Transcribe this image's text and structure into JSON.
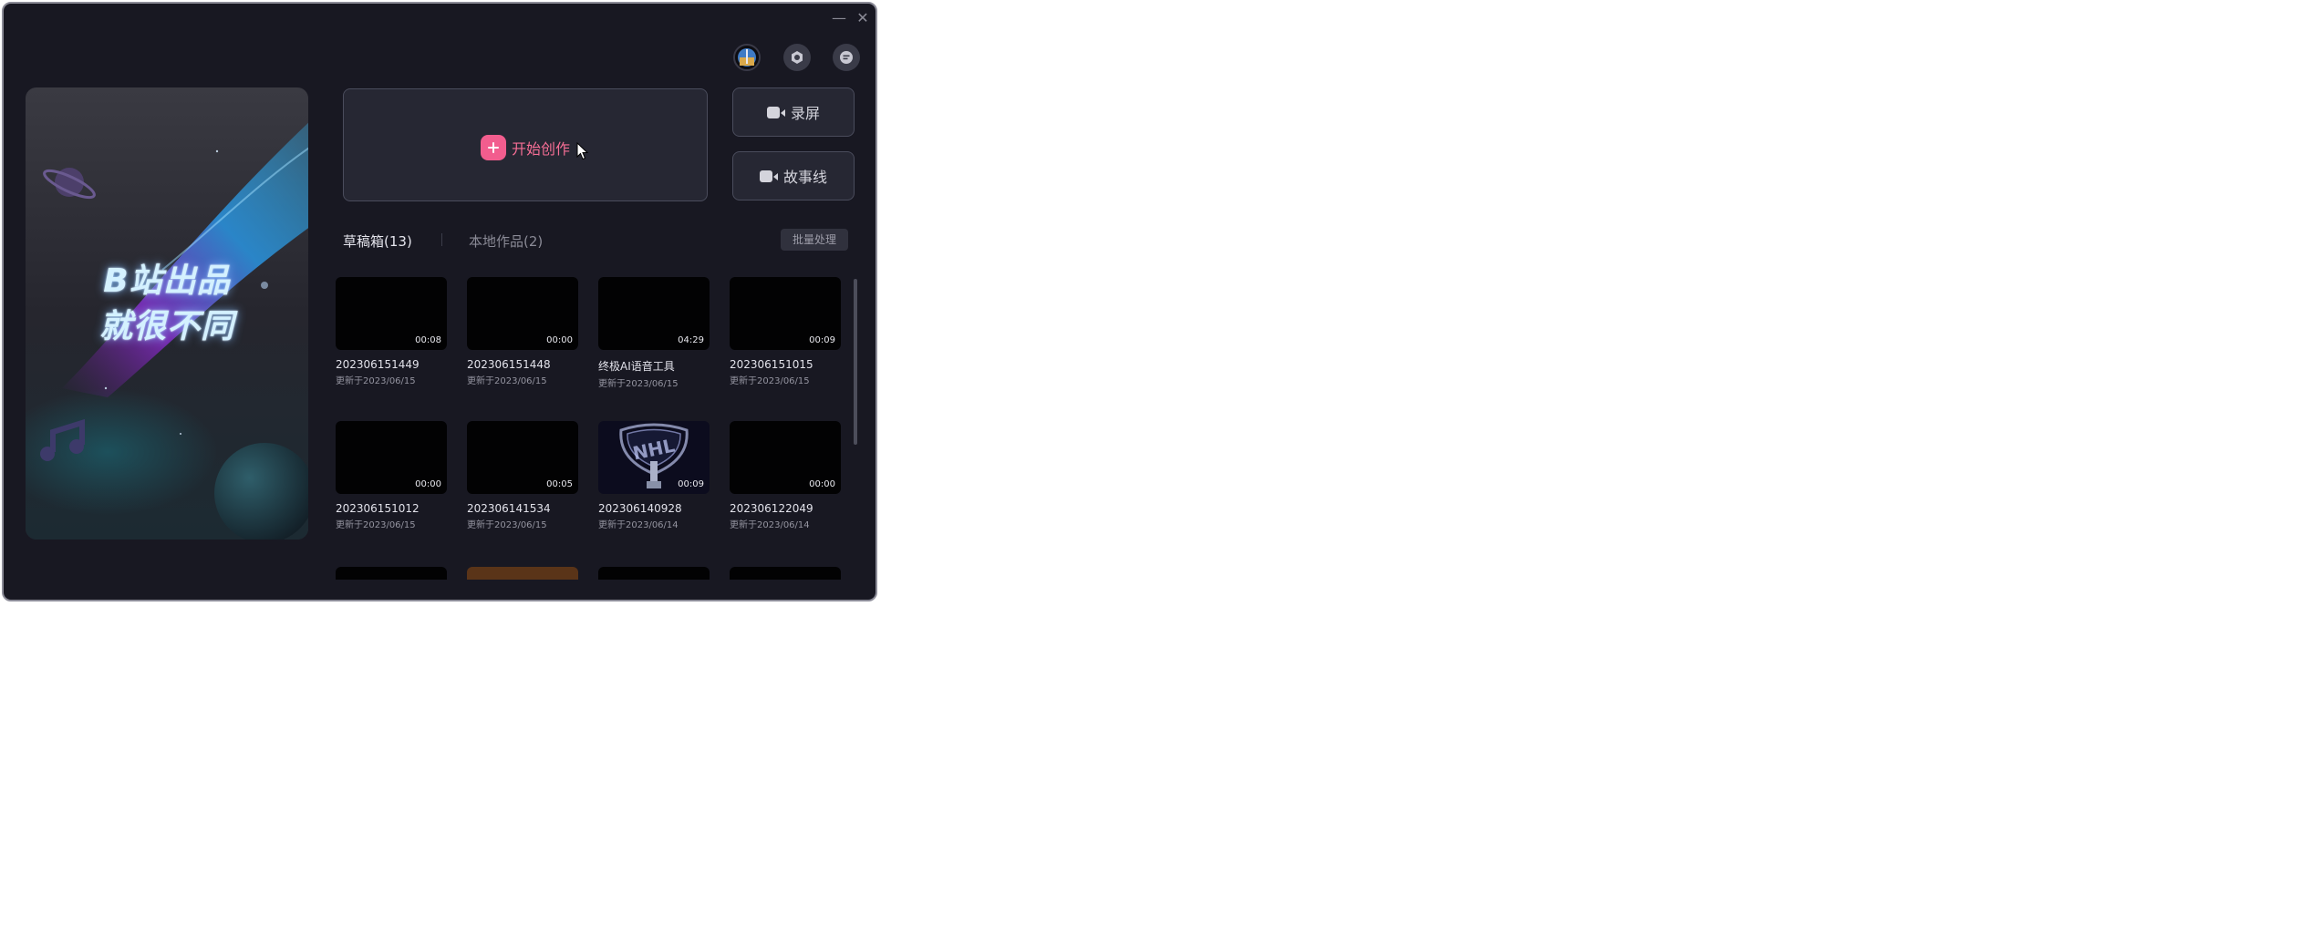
{
  "window": {
    "minimize_label": "—",
    "close_label": "✕"
  },
  "toolbar_icons": [
    "avatar",
    "settings-icon",
    "feedback-icon"
  ],
  "banner": {
    "line1": "B站出品",
    "line2": "就很不同"
  },
  "create": {
    "label": "开始创作"
  },
  "side_buttons": {
    "record": "录屏",
    "storyline": "故事线"
  },
  "tabs": {
    "drafts": "草稿箱(13)",
    "local": "本地作品(2)",
    "batch": "批量处理"
  },
  "cards": [
    {
      "name": "202306151449",
      "date": "更新于2023/06/15",
      "duration": "00:08"
    },
    {
      "name": "202306151448",
      "date": "更新于2023/06/15",
      "duration": "00:00"
    },
    {
      "name": "终极AI语音工具",
      "date": "更新于2023/06/15",
      "duration": "04:29"
    },
    {
      "name": "202306151015",
      "date": "更新于2023/06/15",
      "duration": "00:09"
    },
    {
      "name": "202306151012",
      "date": "更新于2023/06/15",
      "duration": "00:00"
    },
    {
      "name": "202306141534",
      "date": "更新于2023/06/15",
      "duration": "00:05"
    },
    {
      "name": "202306140928",
      "date": "更新于2023/06/14",
      "duration": "00:09"
    },
    {
      "name": "202306122049",
      "date": "更新于2023/06/14",
      "duration": "00:00"
    }
  ],
  "colors": {
    "accent": "#f25d8e",
    "background": "#181822",
    "panel": "#262733"
  }
}
